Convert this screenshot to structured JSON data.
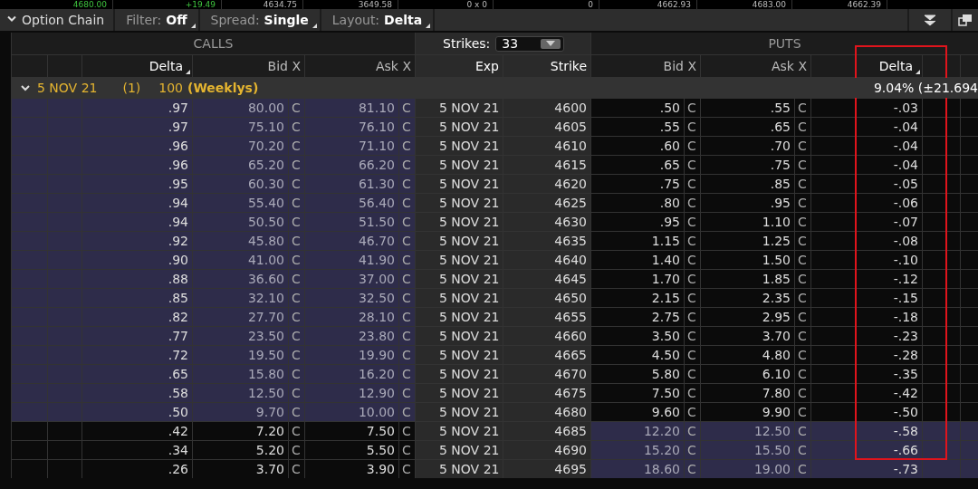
{
  "ticker_strip": [
    {
      "text": "4680.00",
      "kind": "up"
    },
    {
      "text": "+19.49",
      "kind": "up"
    },
    {
      "text": "4634.75",
      "kind": "plain"
    },
    {
      "text": "3649.58",
      "kind": "plain"
    },
    {
      "text": "0 x 0",
      "kind": "plain"
    },
    {
      "text": "0",
      "kind": "plain"
    },
    {
      "text": "4662.93",
      "kind": "plain"
    },
    {
      "text": "4683.00",
      "kind": "plain"
    },
    {
      "text": "4662.39",
      "kind": "plain"
    }
  ],
  "toolbar": {
    "title": "Option Chain",
    "expanded": true,
    "controls": [
      {
        "label": "Filter:",
        "value": "Off"
      },
      {
        "label": "Spread:",
        "value": "Single"
      },
      {
        "label": "Layout:",
        "value": "Delta"
      }
    ]
  },
  "chain": {
    "calls_label": "CALLS",
    "puts_label": "PUTS",
    "strikes": {
      "label": "Strikes:",
      "value": "33"
    },
    "call_columns": [
      {
        "label": "Delta",
        "sorted": true
      },
      {
        "label": "Bid X",
        "sorted": false
      },
      {
        "label": "Ask X",
        "sorted": false
      }
    ],
    "middle_columns": [
      "Exp",
      "Strike"
    ],
    "put_columns": [
      {
        "label": "Bid X",
        "sorted": false,
        "highlighted": false
      },
      {
        "label": "Ask X",
        "sorted": false,
        "highlighted": false
      },
      {
        "label": "Delta",
        "sorted": true,
        "highlighted": true
      }
    ],
    "expiry": {
      "date": "5 NOV 21",
      "count": "(1)",
      "multiplier": "100",
      "series": "(Weeklys)",
      "expanded": true,
      "iv": "9.04% (±21.694"
    },
    "rows": [
      {
        "cd": ".97",
        "cb": "80.00",
        "cbx": "C",
        "ca": "81.10",
        "cax": "C",
        "exp": "5 NOV 21",
        "strike": "4600",
        "pb": ".50",
        "pbx": "C",
        "pa": ".55",
        "pax": "C",
        "pd": "-.03",
        "call_itm": true,
        "put_itm": false
      },
      {
        "cd": ".97",
        "cb": "75.10",
        "cbx": "C",
        "ca": "76.10",
        "cax": "C",
        "exp": "5 NOV 21",
        "strike": "4605",
        "pb": ".55",
        "pbx": "C",
        "pa": ".65",
        "pax": "C",
        "pd": "-.04",
        "call_itm": true,
        "put_itm": false
      },
      {
        "cd": ".96",
        "cb": "70.20",
        "cbx": "C",
        "ca": "71.10",
        "cax": "C",
        "exp": "5 NOV 21",
        "strike": "4610",
        "pb": ".60",
        "pbx": "C",
        "pa": ".70",
        "pax": "C",
        "pd": "-.04",
        "call_itm": true,
        "put_itm": false
      },
      {
        "cd": ".96",
        "cb": "65.20",
        "cbx": "C",
        "ca": "66.20",
        "cax": "C",
        "exp": "5 NOV 21",
        "strike": "4615",
        "pb": ".65",
        "pbx": "C",
        "pa": ".75",
        "pax": "C",
        "pd": "-.04",
        "call_itm": true,
        "put_itm": false
      },
      {
        "cd": ".95",
        "cb": "60.30",
        "cbx": "C",
        "ca": "61.30",
        "cax": "C",
        "exp": "5 NOV 21",
        "strike": "4620",
        "pb": ".75",
        "pbx": "C",
        "pa": ".85",
        "pax": "C",
        "pd": "-.05",
        "call_itm": true,
        "put_itm": false
      },
      {
        "cd": ".94",
        "cb": "55.40",
        "cbx": "C",
        "ca": "56.40",
        "cax": "C",
        "exp": "5 NOV 21",
        "strike": "4625",
        "pb": ".80",
        "pbx": "C",
        "pa": ".95",
        "pax": "C",
        "pd": "-.06",
        "call_itm": true,
        "put_itm": false
      },
      {
        "cd": ".94",
        "cb": "50.50",
        "cbx": "C",
        "ca": "51.50",
        "cax": "C",
        "exp": "5 NOV 21",
        "strike": "4630",
        "pb": ".95",
        "pbx": "C",
        "pa": "1.10",
        "pax": "C",
        "pd": "-.07",
        "call_itm": true,
        "put_itm": false
      },
      {
        "cd": ".92",
        "cb": "45.80",
        "cbx": "C",
        "ca": "46.70",
        "cax": "C",
        "exp": "5 NOV 21",
        "strike": "4635",
        "pb": "1.15",
        "pbx": "C",
        "pa": "1.25",
        "pax": "C",
        "pd": "-.08",
        "call_itm": true,
        "put_itm": false
      },
      {
        "cd": ".90",
        "cb": "41.00",
        "cbx": "C",
        "ca": "41.90",
        "cax": "C",
        "exp": "5 NOV 21",
        "strike": "4640",
        "pb": "1.40",
        "pbx": "C",
        "pa": "1.50",
        "pax": "C",
        "pd": "-.10",
        "call_itm": true,
        "put_itm": false
      },
      {
        "cd": ".88",
        "cb": "36.60",
        "cbx": "C",
        "ca": "37.00",
        "cax": "C",
        "exp": "5 NOV 21",
        "strike": "4645",
        "pb": "1.70",
        "pbx": "C",
        "pa": "1.85",
        "pax": "C",
        "pd": "-.12",
        "call_itm": true,
        "put_itm": false
      },
      {
        "cd": ".85",
        "cb": "32.10",
        "cbx": "C",
        "ca": "32.50",
        "cax": "C",
        "exp": "5 NOV 21",
        "strike": "4650",
        "pb": "2.15",
        "pbx": "C",
        "pa": "2.35",
        "pax": "C",
        "pd": "-.15",
        "call_itm": true,
        "put_itm": false
      },
      {
        "cd": ".82",
        "cb": "27.70",
        "cbx": "C",
        "ca": "28.10",
        "cax": "C",
        "exp": "5 NOV 21",
        "strike": "4655",
        "pb": "2.75",
        "pbx": "C",
        "pa": "2.95",
        "pax": "C",
        "pd": "-.18",
        "call_itm": true,
        "put_itm": false
      },
      {
        "cd": ".77",
        "cb": "23.50",
        "cbx": "C",
        "ca": "23.80",
        "cax": "C",
        "exp": "5 NOV 21",
        "strike": "4660",
        "pb": "3.50",
        "pbx": "C",
        "pa": "3.70",
        "pax": "C",
        "pd": "-.23",
        "call_itm": true,
        "put_itm": false
      },
      {
        "cd": ".72",
        "cb": "19.50",
        "cbx": "C",
        "ca": "19.90",
        "cax": "C",
        "exp": "5 NOV 21",
        "strike": "4665",
        "pb": "4.50",
        "pbx": "C",
        "pa": "4.80",
        "pax": "C",
        "pd": "-.28",
        "call_itm": true,
        "put_itm": false
      },
      {
        "cd": ".65",
        "cb": "15.80",
        "cbx": "C",
        "ca": "16.20",
        "cax": "C",
        "exp": "5 NOV 21",
        "strike": "4670",
        "pb": "5.80",
        "pbx": "C",
        "pa": "6.10",
        "pax": "C",
        "pd": "-.35",
        "call_itm": true,
        "put_itm": false
      },
      {
        "cd": ".58",
        "cb": "12.50",
        "cbx": "C",
        "ca": "12.90",
        "cax": "C",
        "exp": "5 NOV 21",
        "strike": "4675",
        "pb": "7.50",
        "pbx": "C",
        "pa": "7.80",
        "pax": "C",
        "pd": "-.42",
        "call_itm": true,
        "put_itm": false
      },
      {
        "cd": ".50",
        "cb": "9.70",
        "cbx": "C",
        "ca": "10.00",
        "cax": "C",
        "exp": "5 NOV 21",
        "strike": "4680",
        "pb": "9.60",
        "pbx": "C",
        "pa": "9.90",
        "pax": "C",
        "pd": "-.50",
        "call_itm": true,
        "put_itm": false
      },
      {
        "cd": ".42",
        "cb": "7.20",
        "cbx": "C",
        "ca": "7.50",
        "cax": "C",
        "exp": "5 NOV 21",
        "strike": "4685",
        "pb": "12.20",
        "pbx": "C",
        "pa": "12.50",
        "pax": "C",
        "pd": "-.58",
        "call_itm": false,
        "put_itm": true
      },
      {
        "cd": ".34",
        "cb": "5.20",
        "cbx": "C",
        "ca": "5.50",
        "cax": "C",
        "exp": "5 NOV 21",
        "strike": "4690",
        "pb": "15.20",
        "pbx": "C",
        "pa": "15.50",
        "pax": "C",
        "pd": "-.66",
        "call_itm": false,
        "put_itm": true
      },
      {
        "cd": ".26",
        "cb": "3.70",
        "cbx": "C",
        "ca": "3.90",
        "cax": "C",
        "exp": "5 NOV 21",
        "strike": "4695",
        "pb": "18.60",
        "pbx": "C",
        "pa": "19.00",
        "pax": "C",
        "pd": "-.73",
        "call_itm": false,
        "put_itm": true
      }
    ]
  }
}
